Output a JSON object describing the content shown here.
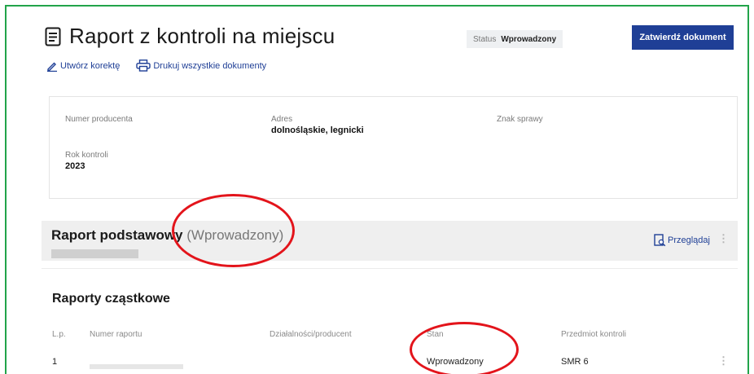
{
  "header": {
    "title": "Raport z kontroli na miejscu",
    "status_label": "Status",
    "status_value": "Wprowadzony",
    "approve_button": "Zatwierdź dokument"
  },
  "actions": {
    "correction": "Utwórz korektę",
    "print_all": "Drukuj wszystkie dokumenty"
  },
  "info": {
    "producer_number_label": "Numer producenta",
    "address_label": "Adres",
    "address_value": "dolnośląskie, legnicki",
    "case_sign_label": "Znak sprawy",
    "year_label": "Rok kontroli",
    "year_value": "2023"
  },
  "basic_report": {
    "title": "Raport podstawowy",
    "state": "(Wprowadzony)",
    "review": "Przeglądaj"
  },
  "partial_reports": {
    "title": "Raporty cząstkowe",
    "columns": [
      "L.p.",
      "Numer raportu",
      "Działalności/producent",
      "Stan",
      "Przedmiot kontroli"
    ],
    "rows": [
      {
        "lp": "1",
        "report_number": "",
        "activity": "",
        "state": "Wprowadzony",
        "subject": "SMR 6"
      }
    ]
  },
  "colors": {
    "accent": "#1f3f96",
    "frame": "#22a44a",
    "annotation": "#e3141b"
  }
}
